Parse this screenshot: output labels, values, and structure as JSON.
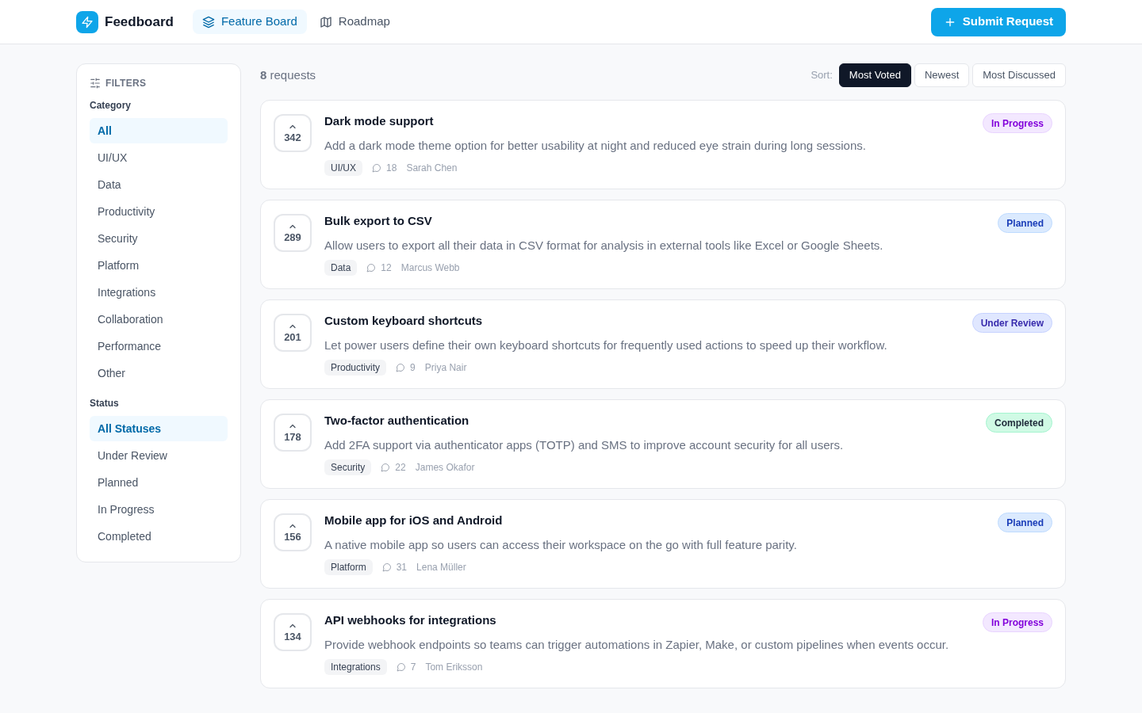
{
  "header": {
    "app_name": "Feedboard",
    "nav": [
      {
        "label": "Feature Board",
        "selected": true
      },
      {
        "label": "Roadmap",
        "selected": false
      }
    ],
    "submit_button": "Submit Request"
  },
  "filters": {
    "title": "FILTERS",
    "groups": [
      {
        "heading": "Category",
        "items": [
          {
            "label": "All",
            "selected": true
          },
          {
            "label": "UI/UX",
            "selected": false
          },
          {
            "label": "Data",
            "selected": false
          },
          {
            "label": "Productivity",
            "selected": false
          },
          {
            "label": "Security",
            "selected": false
          },
          {
            "label": "Platform",
            "selected": false
          },
          {
            "label": "Integrations",
            "selected": false
          },
          {
            "label": "Collaboration",
            "selected": false
          },
          {
            "label": "Performance",
            "selected": false
          },
          {
            "label": "Other",
            "selected": false
          }
        ]
      },
      {
        "heading": "Status",
        "items": [
          {
            "label": "All Statuses",
            "selected": true
          },
          {
            "label": "Under Review",
            "selected": false
          },
          {
            "label": "Planned",
            "selected": false
          },
          {
            "label": "In Progress",
            "selected": false
          },
          {
            "label": "Completed",
            "selected": false
          }
        ]
      }
    ]
  },
  "toolbar": {
    "count": "**8** requests",
    "sort_label": "Sort:",
    "sort_options": [
      {
        "label": "Most Voted",
        "selected": true
      },
      {
        "label": "Newest",
        "selected": false
      },
      {
        "label": "Most Discussed",
        "selected": false
      }
    ]
  },
  "requests": [
    {
      "votes": "342",
      "title": "Dark mode support",
      "description": "Add a dark mode theme option for better usability at night and reduced eye strain during long sessions.",
      "tag": "UI/UX",
      "comments": "18",
      "author": "Sarah Chen",
      "status": {
        "label": "In Progress",
        "kind": "progress"
      }
    },
    {
      "votes": "289",
      "title": "Bulk export to CSV",
      "description": "Allow users to export all their data in CSV format for analysis in external tools like Excel or Google Sheets.",
      "tag": "Data",
      "comments": "12",
      "author": "Marcus Webb",
      "status": {
        "label": "Planned",
        "kind": "planned"
      }
    },
    {
      "votes": "201",
      "title": "Custom keyboard shortcuts",
      "description": "Let power users define their own keyboard shortcuts for frequently used actions to speed up their workflow.",
      "tag": "Productivity",
      "comments": "9",
      "author": "Priya Nair",
      "status": {
        "label": "Under Review",
        "kind": "review"
      }
    },
    {
      "votes": "178",
      "title": "Two-factor authentication",
      "description": "Add 2FA support via authenticator apps (TOTP) and SMS to improve account security for all users.",
      "tag": "Security",
      "comments": "22",
      "author": "James Okafor",
      "status": {
        "label": "Completed",
        "kind": "completed"
      }
    },
    {
      "votes": "156",
      "title": "Mobile app for iOS and Android",
      "description": "A native mobile app so users can access their workspace on the go with full feature parity.",
      "tag": "Platform",
      "comments": "31",
      "author": "Lena Müller",
      "status": {
        "label": "Planned",
        "kind": "planned"
      }
    },
    {
      "votes": "134",
      "title": "API webhooks for integrations",
      "description": "Provide webhook endpoints so teams can trigger automations in Zapier, Make, or custom pipelines when events occur.",
      "tag": "Integrations",
      "comments": "7",
      "author": "Tom Eriksson",
      "status": {
        "label": "In Progress",
        "kind": "progress"
      }
    }
  ]
}
